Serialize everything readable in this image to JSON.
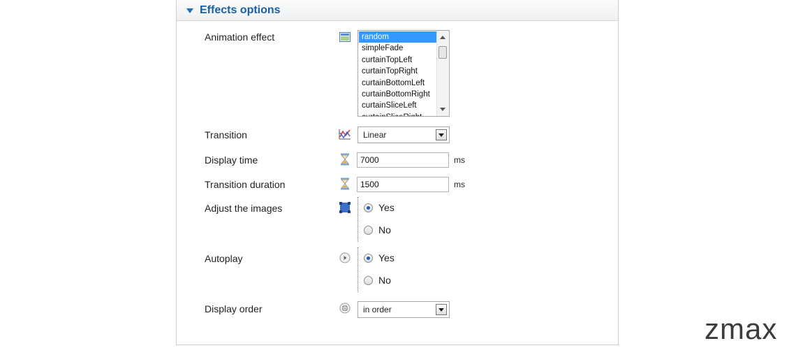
{
  "panel": {
    "title": "Effects options"
  },
  "fields": {
    "animation_effect": {
      "label": "Animation effect",
      "options": [
        "random",
        "simpleFade",
        "curtainTopLeft",
        "curtainTopRight",
        "curtainBottomLeft",
        "curtainBottomRight",
        "curtainSliceLeft",
        "curtainSliceRight"
      ],
      "selected": "random"
    },
    "transition": {
      "label": "Transition",
      "value": "Linear"
    },
    "display_time": {
      "label": "Display time",
      "value": "7000",
      "unit": "ms"
    },
    "transition_duration": {
      "label": "Transition duration",
      "value": "1500",
      "unit": "ms"
    },
    "adjust_images": {
      "label": "Adjust the images",
      "yes": "Yes",
      "no": "No",
      "selected": "Yes"
    },
    "autoplay": {
      "label": "Autoplay",
      "yes": "Yes",
      "no": "No",
      "selected": "Yes"
    },
    "display_order": {
      "label": "Display order",
      "value": "in order"
    }
  },
  "brand": {
    "text": "zmax"
  },
  "icons": {
    "animation_effect": "image-icon",
    "transition": "chart-icon",
    "display_time": "hourglass-icon",
    "transition_duration": "hourglass-icon",
    "adjust_images": "resize-icon",
    "autoplay": "play-icon",
    "display_order": "order-icon"
  }
}
